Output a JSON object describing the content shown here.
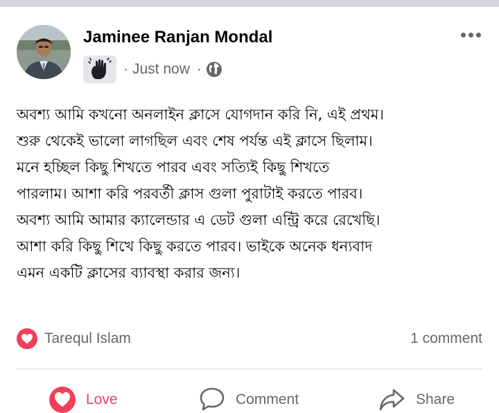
{
  "post": {
    "author_name": "Jaminee Ranjan Mondal",
    "timestamp": "Just now",
    "meta_separator": "·",
    "privacy_icon": "globe-icon",
    "badge_icon": "waving-hand-icon",
    "more_icon": "more-options-icon",
    "text": "অবশ্য আমি কখনো অনলাইন ক্লাসে যোগদান করি নি, এই প্রথম।\nশুরু থেকেই ভালো লাগছিল এবং শেষ পর্যন্ত এই ক্লাসে ছিলাম।\nমনে হচ্ছিল কিছু শিখতে পারব এবং সত্যিই কিছু শিখতে\nপারলাম। আশা করি পরবর্তী ক্লাস গুলা পুরাটাই করতে পারব।\nঅবশ্য আমি আমার ক্যালেন্ডার এ ডেট গুলা এন্ট্রি করে রেখেছি।\nআশা করি কিছু শিখে কিছু করতে পারব। ভাইকে অনেক ধন্যবাদ\nএমন একটি ক্লাসের ব্যাবস্থা করার জন্য।"
  },
  "reactions": {
    "icon": "love-reaction-icon",
    "reactor_name": "Tarequl Islam",
    "comment_count": "1 comment"
  },
  "actions": {
    "love_label": "Love",
    "comment_label": "Comment",
    "share_label": "Share"
  },
  "colors": {
    "love": "#f33e58",
    "secondary_text": "#65676b",
    "primary_text": "#050505",
    "badge_bg": "#e4e6eb",
    "divider": "#ced0d4",
    "top_strip": "#d4d6da"
  }
}
